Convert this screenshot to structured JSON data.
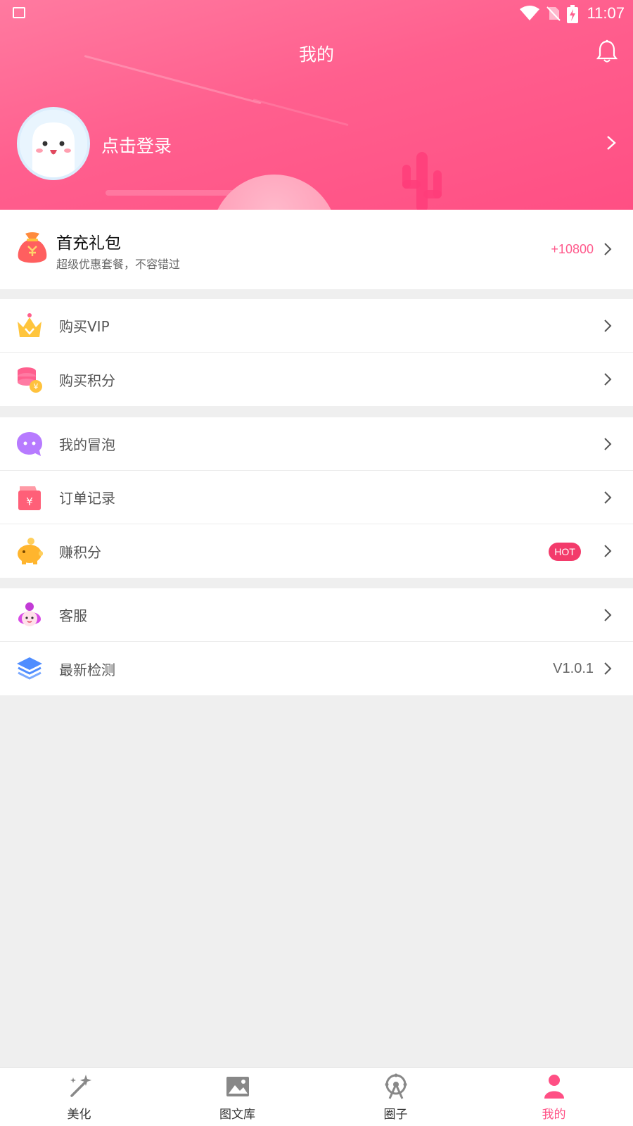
{
  "status_bar": {
    "time": "11:07"
  },
  "header": {
    "title": "我的",
    "login_text": "点击登录"
  },
  "gift": {
    "title": "首充礼包",
    "subtitle": "超级优惠套餐，不容错过",
    "amount": "+10800"
  },
  "menu": {
    "vip": "购买VIP",
    "points": "购买积分",
    "bubble": "我的冒泡",
    "orders": "订单记录",
    "earn": "赚积分",
    "hot_badge": "HOT",
    "service": "客服",
    "update": "最新检测",
    "version": "V1.0.1"
  },
  "tabs": [
    {
      "label": "美化",
      "icon": "magic-wand-icon"
    },
    {
      "label": "图文库",
      "icon": "image-icon"
    },
    {
      "label": "圈子",
      "icon": "ferris-wheel-icon"
    },
    {
      "label": "我的",
      "icon": "person-icon"
    }
  ],
  "colors": {
    "accent": "#ff4f84",
    "hot": "#f33b6b",
    "amount": "#ff5a8c"
  }
}
